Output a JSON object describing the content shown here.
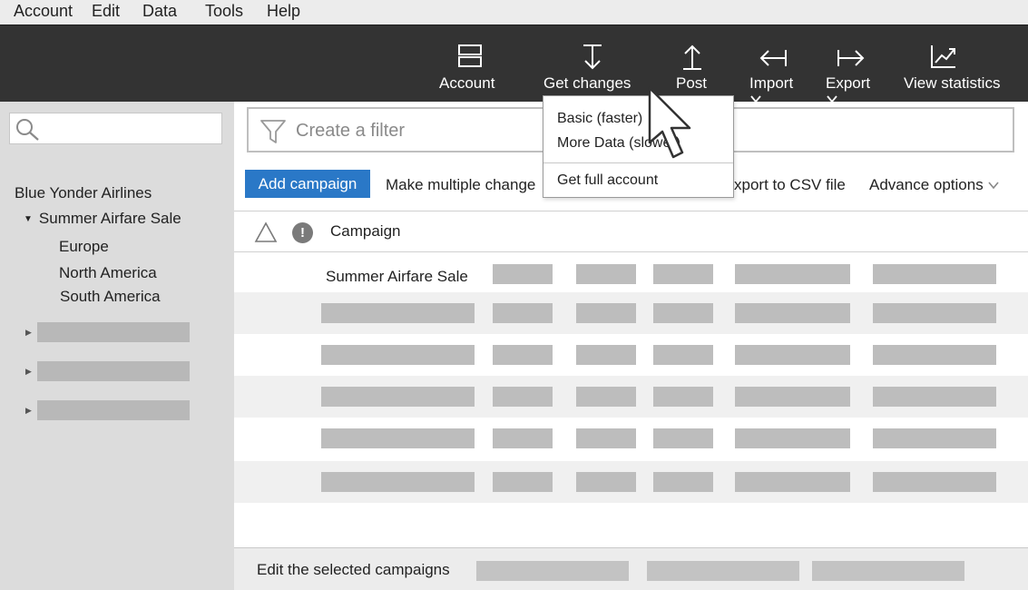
{
  "menu": {
    "items": [
      "Account",
      "Edit",
      "Data",
      "Tools",
      "Help"
    ]
  },
  "toolbar": {
    "account_label": "Account",
    "get_changes_label": "Get changes",
    "post_label": "Post",
    "import_label": "Import",
    "export_label": "Export",
    "view_stats_label": "View statistics"
  },
  "dropdown": {
    "options": [
      "Basic (faster)",
      "More Data (slower)",
      "Get full account"
    ]
  },
  "sidebar": {
    "search_placeholder": "",
    "account": "Blue Yonder Airlines",
    "campaign": "Summer Airfare Sale",
    "ad_groups": [
      "Europe",
      "North America",
      "South America"
    ]
  },
  "filter": {
    "placeholder": "Create a filter"
  },
  "actions": {
    "add_campaign": "Add campaign",
    "make_multiple_changes": "Make multiple change",
    "export_csv": "xport to CSV file",
    "advance_options": "Advance options"
  },
  "grid": {
    "column_title": "Campaign",
    "first_row_name": "Summer Airfare Sale"
  },
  "footer": {
    "label": "Edit the selected campaigns"
  },
  "colors": {
    "toolbar_bg": "#333333",
    "accent_button": "#2a78c7",
    "sidebar_bg": "#dcdcdc"
  }
}
